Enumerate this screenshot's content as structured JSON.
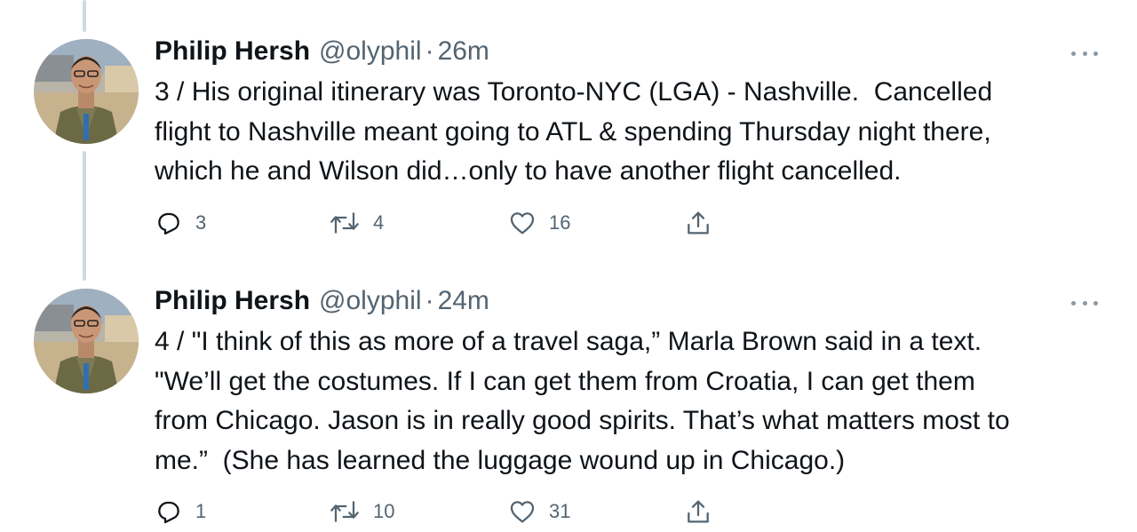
{
  "colors": {
    "text": "#0f1419",
    "secondary": "#536471",
    "thread_line": "#cfd9de"
  },
  "tweets": [
    {
      "author_name": "Philip Hersh",
      "handle": "@olyphil",
      "separator": "·",
      "time": "26m",
      "text": "3 / His original itinerary was Toronto-NYC (LGA) - Nashville.  Cancelled\nflight to Nashville meant going to ATL & spending Thursday night there,\nwhich he and Wilson did…only to have another flight cancelled.",
      "replies": "3",
      "retweets": "4",
      "likes": "16",
      "icons": {
        "reply": "reply-icon",
        "retweet": "retweet-icon",
        "like": "heart-icon",
        "share": "share-icon",
        "more": "more-icon"
      }
    },
    {
      "author_name": "Philip Hersh",
      "handle": "@olyphil",
      "separator": "·",
      "time": "24m",
      "text": "4 / \"I think of this as more of a travel saga,” Marla Brown said in a text.\n\"We’ll get the costumes. If I can get them from Croatia, I can get them\nfrom Chicago. Jason is in really good spirits. That’s what matters most to\nme.”  (She has learned the luggage wound up in Chicago.)",
      "replies": "1",
      "retweets": "10",
      "likes": "31",
      "icons": {
        "reply": "reply-icon",
        "retweet": "retweet-icon",
        "like": "heart-icon",
        "share": "share-icon",
        "more": "more-icon"
      }
    }
  ]
}
